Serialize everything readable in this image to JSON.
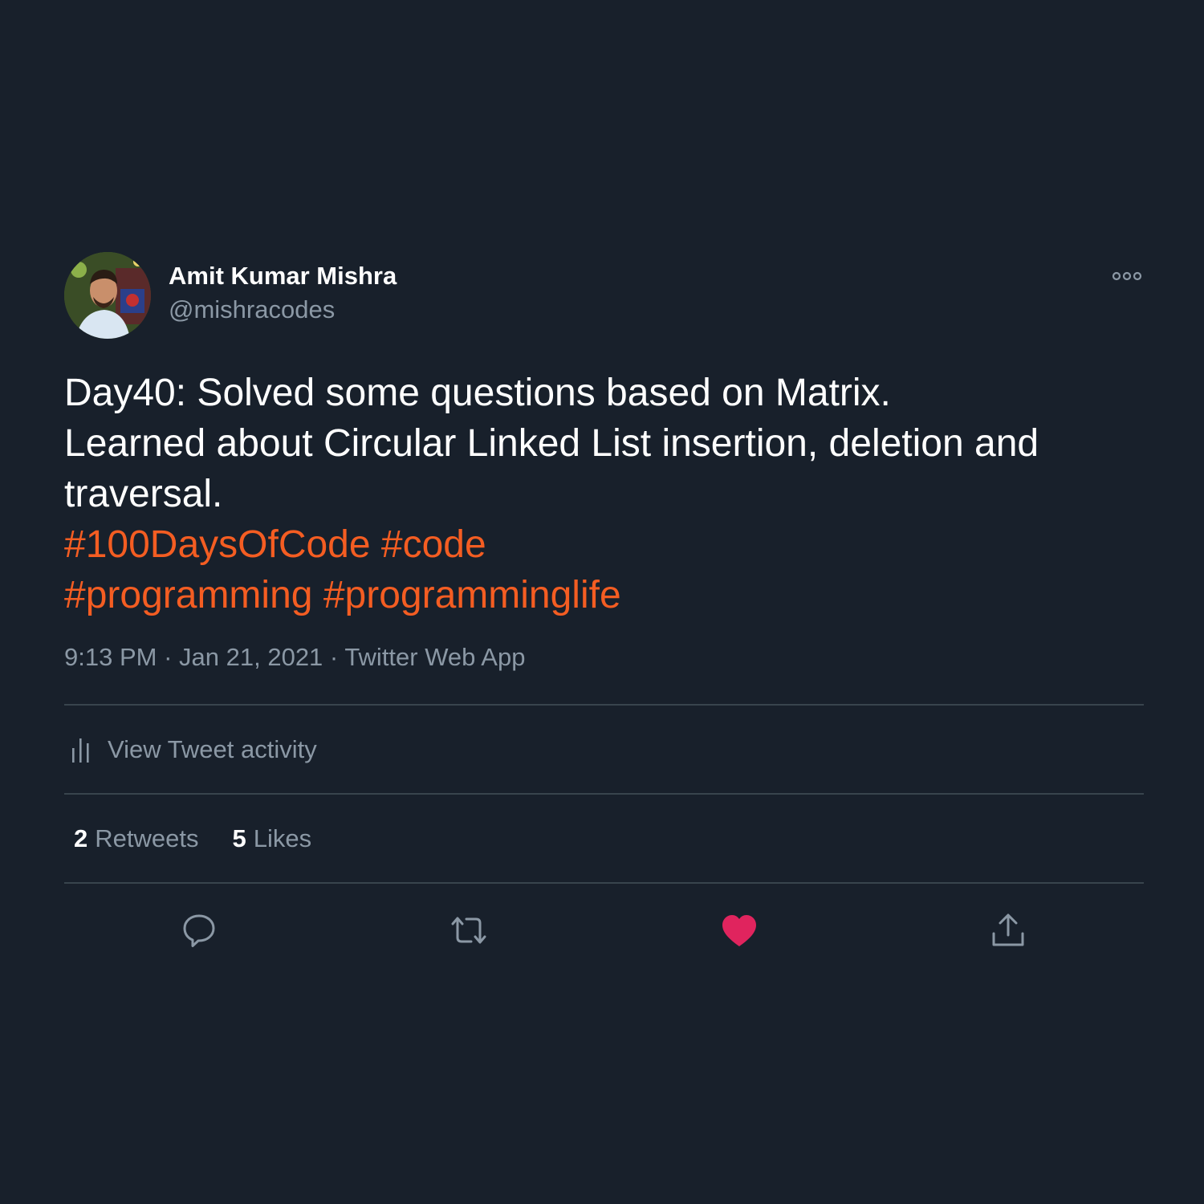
{
  "author": {
    "display_name": "Amit Kumar Mishra",
    "handle": "@mishracodes"
  },
  "tweet": {
    "lines": [
      "Day40: Solved some questions based on Matrix.",
      "Learned about Circular Linked List insertion, deletion and",
      "traversal."
    ],
    "hashtags": [
      "#100DaysOfCode",
      "#code",
      "#programming",
      "#programminglife"
    ]
  },
  "meta": {
    "time": "9:13 PM",
    "separator": "·",
    "date": "Jan 21, 2021",
    "source": "Twitter Web App"
  },
  "activity": {
    "label": "View Tweet activity",
    "icon": "bar-chart-icon"
  },
  "stats": {
    "retweets_count": "2",
    "retweets_label": "Retweets",
    "likes_count": "5",
    "likes_label": "Likes"
  },
  "actions": {
    "icons": [
      "reply-icon",
      "retweet-icon",
      "like-icon",
      "share-icon"
    ],
    "liked": true
  },
  "colors": {
    "background": "#18202b",
    "hashtag": "#f45d22",
    "secondary_text": "#8b98a5",
    "divider": "#38444d",
    "like": "#e0245e"
  }
}
